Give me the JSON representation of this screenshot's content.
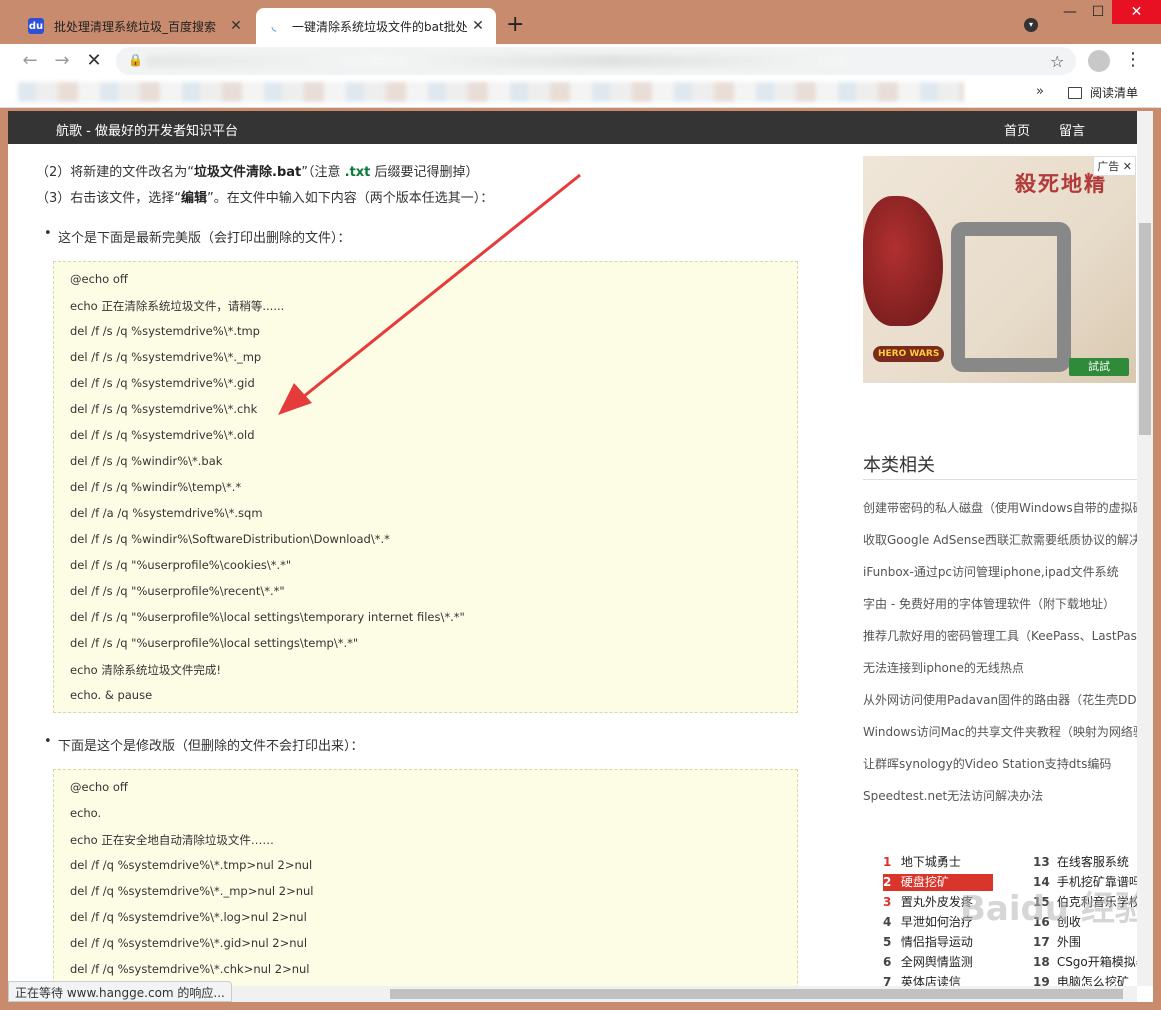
{
  "browser": {
    "tabs": [
      {
        "title": "批处理清理系统垃圾_百度搜索",
        "active": false
      },
      {
        "title": "一键清除系统垃圾文件的bat批处",
        "active": true
      }
    ],
    "bookmark_overflow": "»",
    "reading_list": "阅读清单",
    "status_text": "正在等待 www.hangge.com 的响应..."
  },
  "site": {
    "brand": "航歌 - 做最好的开发者知识平台",
    "nav": [
      "首页",
      "留言"
    ]
  },
  "article": {
    "step2_a": "（2）将新建的文件改名为“",
    "step2_b": "垃圾文件清除.bat",
    "step2_c": "”（注意 ",
    "step2_d": ".txt",
    "step2_e": " 后缀要记得删掉）",
    "step3_a": "（3）右击该文件，选择“",
    "step3_b": "编辑",
    "step3_c": "”。在文件中输入如下内容（两个版本任选其一）：",
    "bullet1": "这个是下面是最新完美版（会打印出删除的文件）：",
    "code1": [
      "@echo off",
      "echo 正在清除系统垃圾文件，请稍等......",
      "del /f /s /q %systemdrive%\\*.tmp",
      "del /f /s /q %systemdrive%\\*._mp",
      "del /f /s /q %systemdrive%\\*.gid",
      "del /f /s /q %systemdrive%\\*.chk",
      "del /f /s /q %systemdrive%\\*.old",
      "del /f /s /q %windir%\\*.bak",
      "del /f /s /q %windir%\\temp\\*.*",
      "del /f /a /q %systemdrive%\\*.sqm",
      "del /f /s /q %windir%\\SoftwareDistribution\\Download\\*.*",
      "del /f /s /q \"%userprofile%\\cookies\\*.*\"",
      "del /f /s /q \"%userprofile%\\recent\\*.*\"",
      "del /f /s /q \"%userprofile%\\local settings\\temporary internet files\\*.*\"",
      "del /f /s /q \"%userprofile%\\local settings\\temp\\*.*\"",
      "echo 清除系统垃圾文件完成!",
      "echo. & pause"
    ],
    "bullet2": "下面是这个是修改版（但删除的文件不会打印出来）：",
    "code2": [
      "@echo off",
      "echo.",
      "echo 正在安全地自动清除垃圾文件……",
      "del /f /q %systemdrive%\\*.tmp>nul 2>nul",
      "del /f /q %systemdrive%\\*._mp>nul 2>nul",
      "del /f /q %systemdrive%\\*.log>nul 2>nul",
      "del /f /q %systemdrive%\\*.gid>nul 2>nul",
      "del /f /q %systemdrive%\\*.chk>nul 2>nul"
    ]
  },
  "sidebar": {
    "ad_tag": "广告",
    "ad_title": "殺死地精",
    "ad_button": "試試",
    "ad_logo": "HERO WARS",
    "related_title": "本类相关",
    "related": [
      "创建带密码的私人磁盘（使用Windows自带的虚拟磁",
      "收取Google AdSense西联汇款需要纸质协议的解决办",
      "iFunbox-通过pc访问管理iphone,ipad文件系统",
      "字由 - 免费好用的字体管理软件（附下载地址）",
      "推荐几款好用的密码管理工具（KeePass、LastPass",
      "无法连接到iphone的无线热点",
      "从外网访问使用Padavan固件的路由器（花生壳DDN",
      "Windows访问Mac的共享文件夹教程（映射为网络驱",
      "让群晖synology的Video Station支持dts编码",
      "Speedtest.net无法访问解决办法"
    ],
    "rank_left": [
      {
        "num": "1",
        "text": "地下城勇士"
      },
      {
        "num": "2",
        "text": "硬盘挖矿"
      },
      {
        "num": "3",
        "text": "置丸外皮发疼"
      },
      {
        "num": "4",
        "text": "早泄如何治疗"
      },
      {
        "num": "5",
        "text": "情侣指导运动"
      },
      {
        "num": "6",
        "text": "全网舆情监测"
      },
      {
        "num": "7",
        "text": "英体店读信"
      }
    ],
    "rank_right": [
      {
        "num": "13",
        "text": "在线客服系统"
      },
      {
        "num": "14",
        "text": "手机挖矿靠谱吗"
      },
      {
        "num": "15",
        "text": "伯克利音乐学校"
      },
      {
        "num": "16",
        "text": "创收"
      },
      {
        "num": "17",
        "text": "外围"
      },
      {
        "num": "18",
        "text": "CSgo开箱模拟器"
      },
      {
        "num": "19",
        "text": "电脑怎么挖矿"
      }
    ],
    "watermark": "Baidu 经验"
  },
  "colors": {
    "chrome_frame": "#c98b6e",
    "nav_bar": "#343434",
    "code_bg": "#fdfde6",
    "arrow": "#e63b3b",
    "rank_highlight": "#d9352b"
  },
  "icons": {
    "back": "arrow-left-icon",
    "forward": "arrow-right-icon",
    "stop": "close-icon",
    "lock": "lock-icon",
    "star": "star-icon",
    "menu": "vertical-dots-icon"
  }
}
